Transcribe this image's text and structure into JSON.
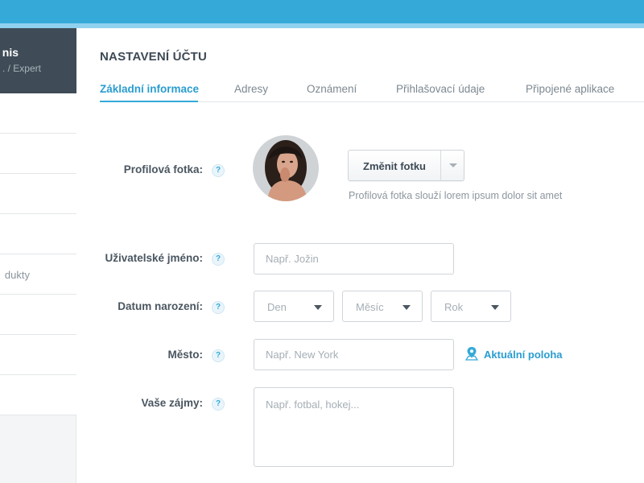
{
  "sidebar": {
    "profile_name": "nis",
    "profile_role": ". / Expert",
    "items": [
      {
        "label": ""
      },
      {
        "label": ""
      },
      {
        "label": ""
      },
      {
        "label": ""
      },
      {
        "label": "dukty"
      },
      {
        "label": ""
      },
      {
        "label": ""
      }
    ]
  },
  "page": {
    "title": "NASTAVENÍ ÚČTU",
    "tabs": [
      {
        "label": "Základní informace",
        "active": true
      },
      {
        "label": "Adresy"
      },
      {
        "label": "Oznámení"
      },
      {
        "label": "Přihlašovací údaje"
      },
      {
        "label": "Připojené aplikace"
      }
    ]
  },
  "form": {
    "help_glyph": "?",
    "photo": {
      "label": "Profilová fotka:",
      "button_label": "Změnit fotku",
      "hint": "Profilová fotka slouží lorem ipsum dolor sit amet"
    },
    "username": {
      "label": "Uživatelské jméno:",
      "placeholder": "Např. Jožin"
    },
    "birthdate": {
      "label": "Datum narození:",
      "day": "Den",
      "month": "Měsíc",
      "year": "Rok"
    },
    "city": {
      "label": "Město:",
      "placeholder": "Např. New York",
      "location_link": "Aktuální poloha"
    },
    "interests": {
      "label": "Vaše zájmy:",
      "placeholder": "Např. fotbal, hokej..."
    }
  },
  "colors": {
    "accent": "#35aad8",
    "accent_light": "#8fd1ee",
    "sidebar_dark": "#3f4c57"
  },
  "icons": {
    "help": "question-icon",
    "caret": "caret-down-icon",
    "location": "map-pin-icon"
  }
}
